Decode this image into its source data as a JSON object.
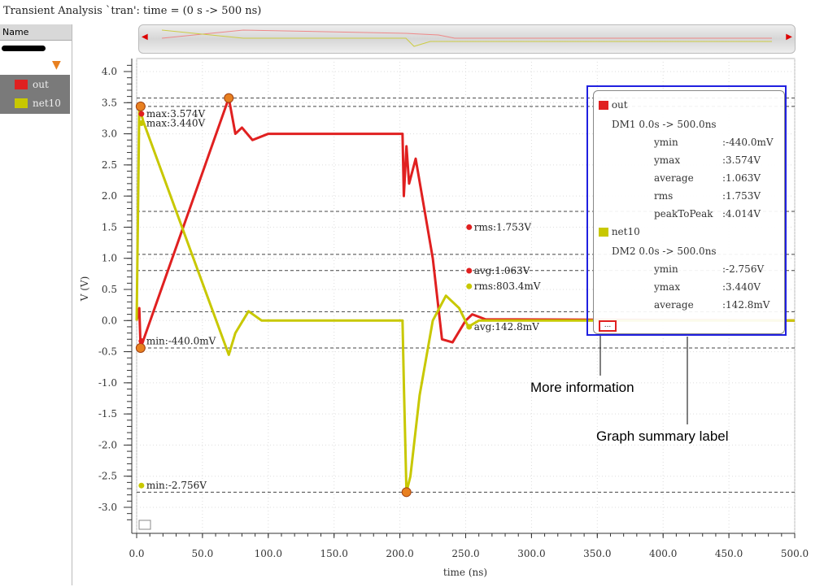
{
  "title": "Transient Analysis `tran': time = (0 s -> 500 ns)",
  "sidebar": {
    "header": "Name",
    "signals": [
      {
        "name": "out",
        "color": "#e02020"
      },
      {
        "name": "net10",
        "color": "#c8c800"
      }
    ]
  },
  "chart_data": {
    "type": "line",
    "xlabel": "time (ns)",
    "ylabel": "V (V)",
    "xlim": [
      0,
      500
    ],
    "ylim": [
      -3.0,
      4.0
    ],
    "xticks": [
      "0.0",
      "50.0",
      "100.0",
      "150.0",
      "200.0",
      "250.0",
      "300.0",
      "350.0",
      "400.0",
      "450.0",
      "500.0"
    ],
    "yticks": [
      "4.0",
      "3.5",
      "3.0",
      "2.5",
      "2.0",
      "1.5",
      "1.0",
      "0.5",
      "0.0",
      "-0.5",
      "-1.0",
      "-1.5",
      "-2.0",
      "-2.5",
      "-3.0"
    ],
    "series": [
      {
        "name": "out",
        "color": "#e02020",
        "points": [
          [
            0,
            0
          ],
          [
            2,
            0.2
          ],
          [
            3,
            -0.44
          ],
          [
            70,
            3.574
          ],
          [
            75,
            3.0
          ],
          [
            80,
            3.1
          ],
          [
            88,
            2.9
          ],
          [
            100,
            3.0
          ],
          [
            202,
            3.0
          ],
          [
            203,
            2.0
          ],
          [
            205,
            2.8
          ],
          [
            207,
            2.2
          ],
          [
            212,
            2.6
          ],
          [
            225,
            1.0
          ],
          [
            232,
            -0.3
          ],
          [
            240,
            -0.35
          ],
          [
            250,
            0.0
          ],
          [
            255,
            0.1
          ],
          [
            265,
            0.02
          ],
          [
            500,
            0.0
          ]
        ]
      },
      {
        "name": "net10",
        "color": "#c8c800",
        "points": [
          [
            0,
            0
          ],
          [
            2,
            3.44
          ],
          [
            5,
            3.2
          ],
          [
            70,
            -0.55
          ],
          [
            75,
            -0.2
          ],
          [
            85,
            0.15
          ],
          [
            95,
            0.0
          ],
          [
            202,
            0.0
          ],
          [
            203,
            -1.0
          ],
          [
            205,
            -2.756
          ],
          [
            208,
            -2.5
          ],
          [
            215,
            -1.2
          ],
          [
            225,
            0.0
          ],
          [
            235,
            0.4
          ],
          [
            245,
            0.2
          ],
          [
            252,
            -0.1
          ],
          [
            260,
            0.0
          ],
          [
            500,
            0.0
          ]
        ]
      }
    ],
    "reference_lines": [
      3.574,
      3.44,
      1.753,
      1.063,
      0.8034,
      0.1428,
      -0.44,
      -2.756
    ],
    "extrema_markers": [
      [
        3,
        3.44
      ],
      [
        70,
        3.574
      ],
      [
        3,
        -0.44
      ],
      [
        205,
        -2.756
      ]
    ],
    "annotations": [
      {
        "text": "max:3.574V",
        "t": 3,
        "v": 3.32,
        "color": "#e02020"
      },
      {
        "text": "max:3.440V",
        "t": 3,
        "v": 3.17,
        "color": "#c8c800"
      },
      {
        "text": "min:-440.0mV",
        "t": 3,
        "v": -0.33,
        "color": "#e02020"
      },
      {
        "text": "min:-2.756V",
        "t": 3,
        "v": -2.65,
        "color": "#c8c800"
      },
      {
        "text": "rms:1.753V",
        "t": 252,
        "v": 1.5,
        "color": "#e02020"
      },
      {
        "text": "avg:1.063V",
        "t": 252,
        "v": 0.8,
        "color": "#e02020"
      },
      {
        "text": "rms:803.4mV",
        "t": 252,
        "v": 0.55,
        "color": "#c8c800"
      },
      {
        "text": "avg:142.8mV",
        "t": 252,
        "v": -0.1,
        "color": "#c8c800"
      }
    ]
  },
  "legend": {
    "out": {
      "name": "out",
      "range": "DM1 0.0s -> 500.0ns",
      "rows": [
        [
          "ymin",
          ":-440.0mV"
        ],
        [
          "ymax",
          ":3.574V"
        ],
        [
          "average",
          ":1.063V"
        ],
        [
          "rms",
          ":1.753V"
        ],
        [
          "peakToPeak",
          ":4.014V"
        ]
      ]
    },
    "net10": {
      "name": "net10",
      "range": "DM2 0.0s -> 500.0ns",
      "rows": [
        [
          "ymin",
          ":-2.756V"
        ],
        [
          "ymax",
          ":3.440V"
        ],
        [
          "average",
          ":142.8mV"
        ]
      ]
    },
    "more": "..."
  },
  "callouts": {
    "more": "More information",
    "summary": "Graph summary label"
  }
}
